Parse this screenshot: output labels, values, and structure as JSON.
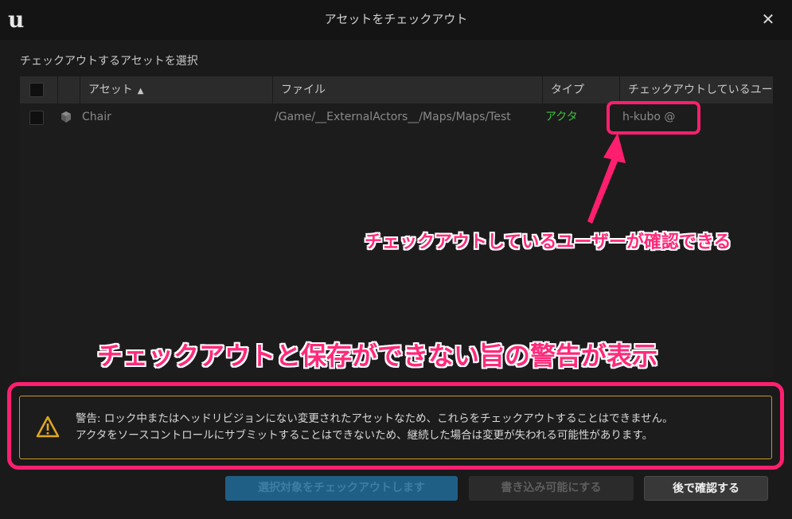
{
  "window": {
    "title": "アセットをチェックアウト",
    "close_glyph": "✕",
    "logo_glyph": "u"
  },
  "section_label": "チェックアウトするアセットを選択",
  "table": {
    "columns": [
      "アセット",
      "ファイル",
      "タイプ",
      "チェックアウトしているユーザー"
    ],
    "sort_glyph": "▲",
    "rows": [
      {
        "asset": "Chair",
        "file": "/Game/__ExternalActors__/Maps/Maps/Test",
        "type": "アクタ",
        "checked_out_by": "h-kubo @"
      }
    ]
  },
  "annotations": {
    "checked_out_user": "チェックアウトしているユーザーが確認できる",
    "warning_note": "チェックアウトと保存ができない旨の警告が表示"
  },
  "warning": {
    "line1": "警告: ロック中またはヘッドリビジョンにない変更されたアセットなため、これらをチェックアウトすることはできません。",
    "line2": "アクタをソースコントロールにサブミットすることはできないため、継続した場合は変更が失われる可能性があります。"
  },
  "buttons": {
    "checkout_selected": "選択対象をチェックアウトします",
    "make_writable": "書き込み可能にする",
    "check_later": "後で確認する"
  },
  "colors": {
    "accent_pink": "#ff1f6e",
    "type_green": "#3fbf3f",
    "warning_amber": "#c99a1f",
    "primary_button": "#1f5f86"
  }
}
